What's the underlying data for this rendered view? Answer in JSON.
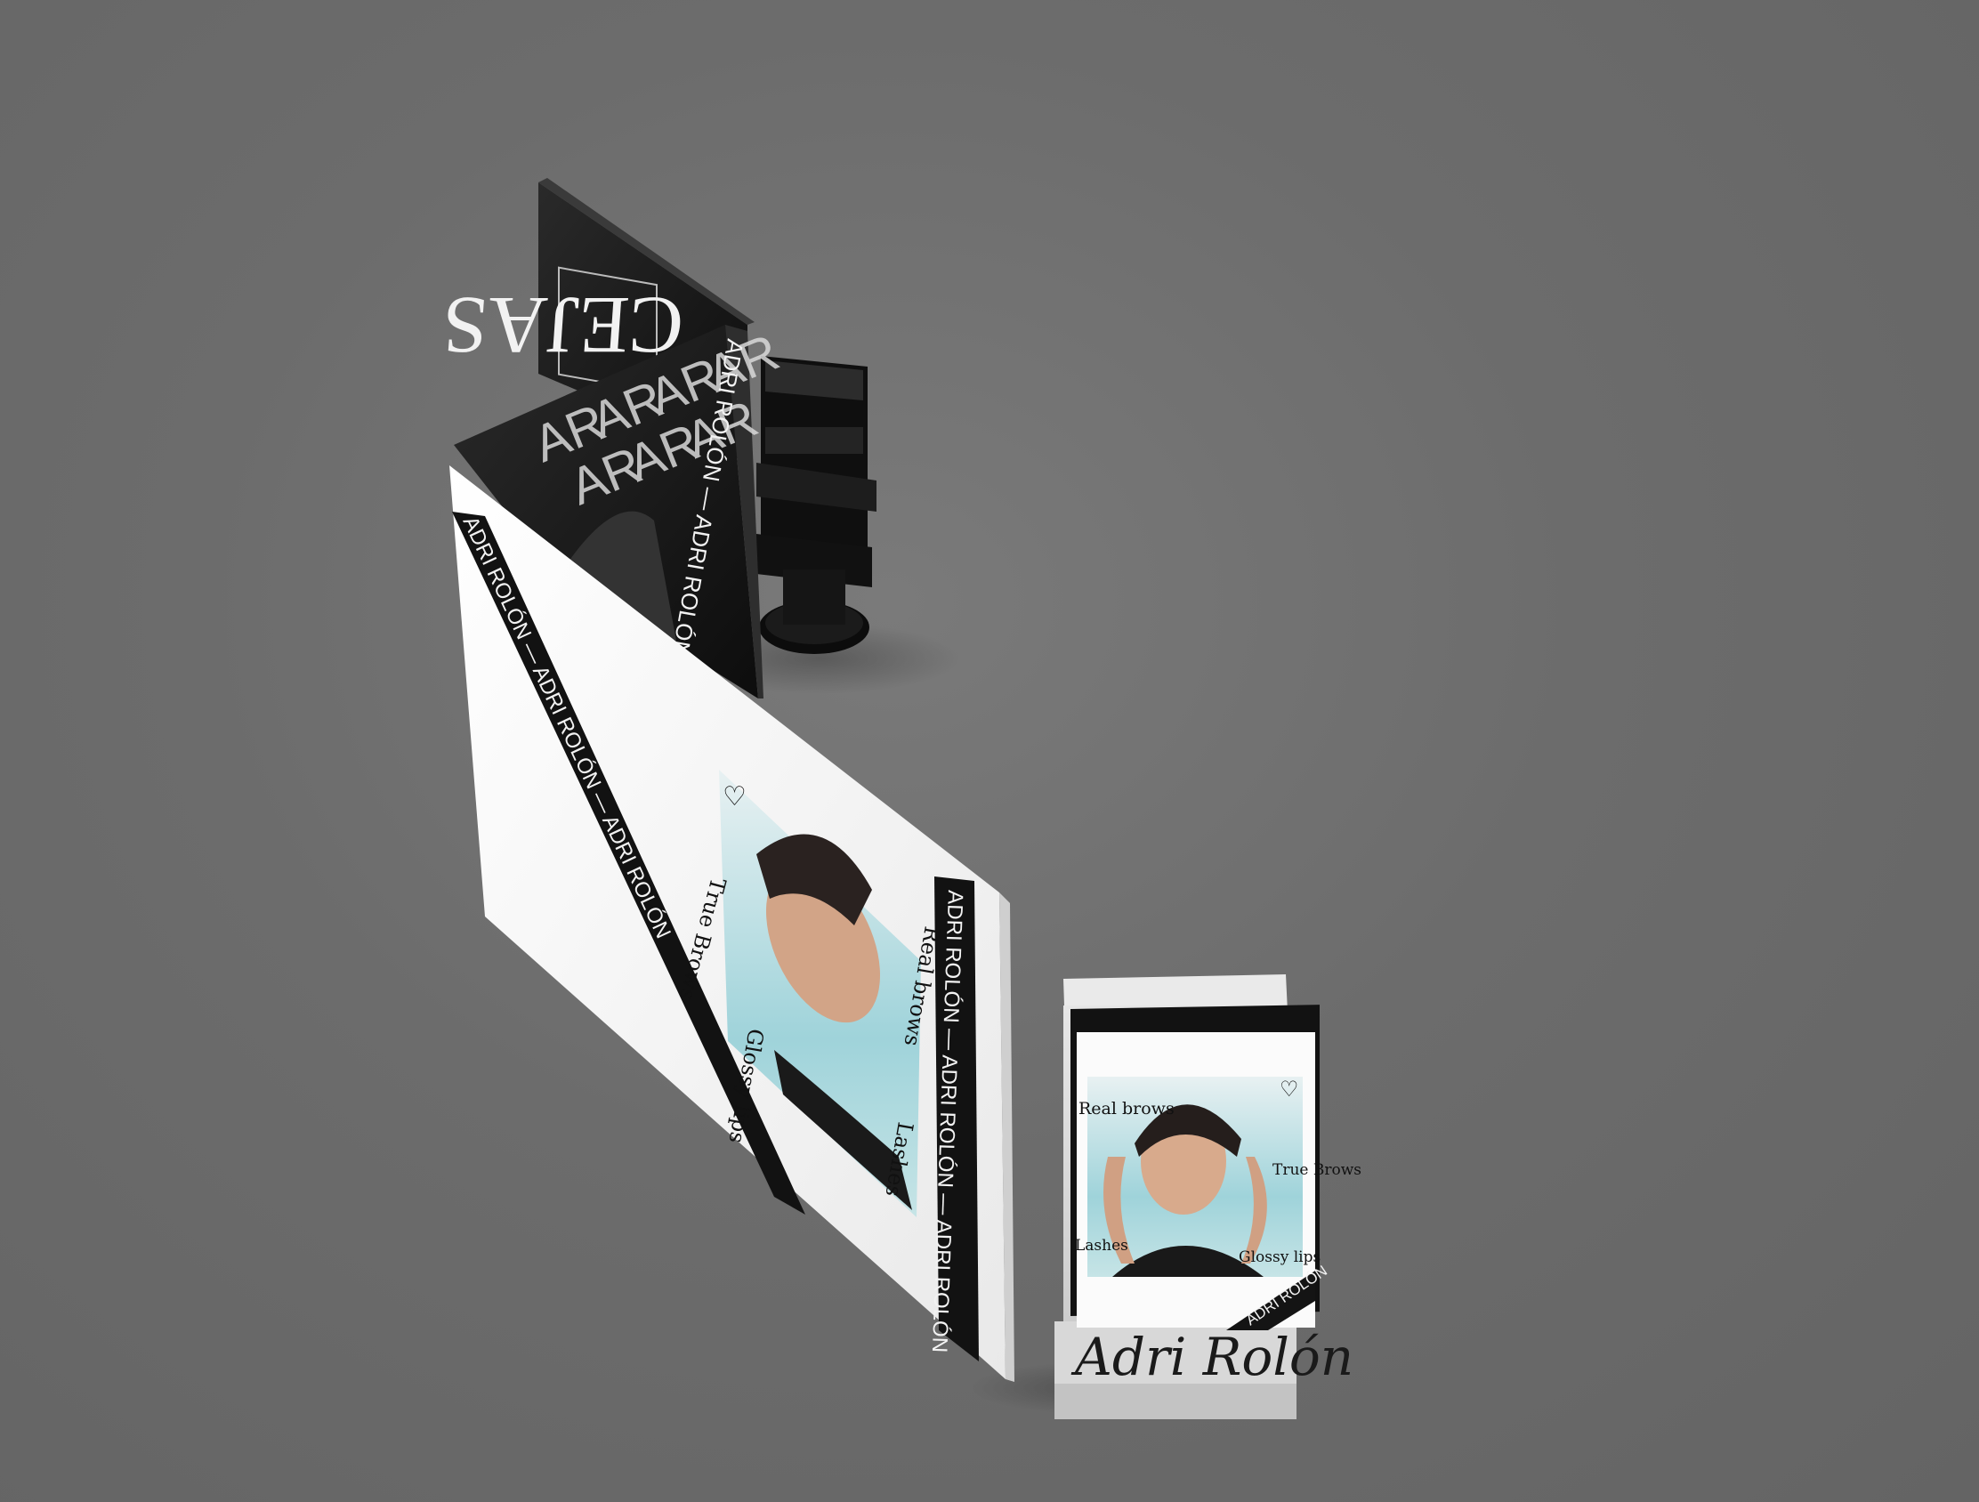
{
  "brand": {
    "name_upper": "ADRI ROLÓN",
    "name_repeat": "ADRI ROLÓN — ADRI ROLÓN — ADRI ROLÓN",
    "monogram": "AR",
    "back_panel_word": "CEJAS",
    "script_signature": "Adri Rolón"
  },
  "annotations": {
    "real_brows": "Real brows",
    "true_brows": "True Brows",
    "glossy_lips": "Glossy lips",
    "lashes": "Lashes",
    "heart": "♡"
  },
  "colors": {
    "background": "#6c6c6c",
    "panel_white": "#f5f5f5",
    "panel_black": "#141414",
    "stand_gray": "#d6d6d6"
  }
}
